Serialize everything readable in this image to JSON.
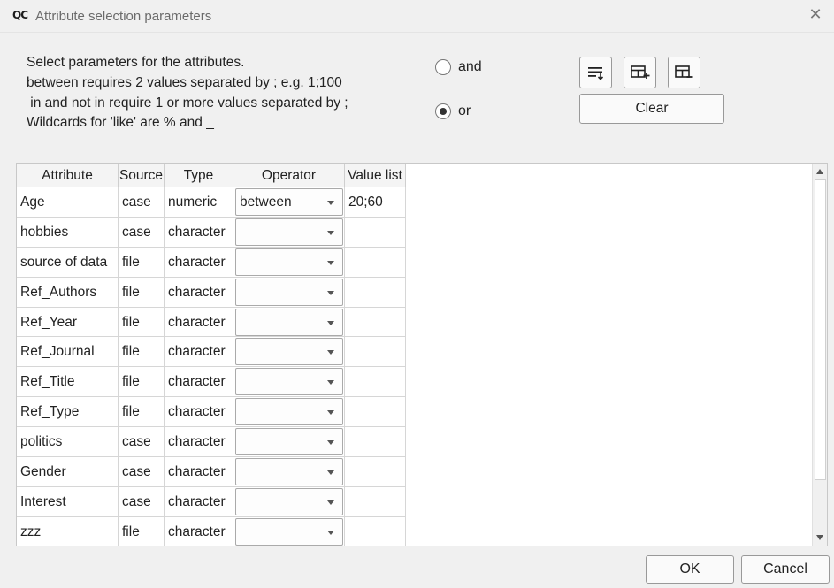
{
  "window": {
    "app_icon": "QC",
    "title": "Attribute selection parameters",
    "close_icon": "close-icon"
  },
  "instructions": [
    "Select parameters for the attributes.",
    "between requires 2 values separated by ; e.g. 1;100",
    " in and not in require 1 or more values separated by ;",
    "Wildcards for 'like' are % and _"
  ],
  "logic": {
    "and_label": "and",
    "or_label": "or",
    "selected": "or"
  },
  "toolbar": {
    "icons": [
      "sort-filter-icon",
      "add-row-icon",
      "remove-row-icon"
    ],
    "clear_label": "Clear"
  },
  "table": {
    "headers": [
      "Attribute",
      "Source",
      "Type",
      "Operator",
      "Value list"
    ],
    "rows": [
      {
        "attribute": "Age",
        "source": "case",
        "type": "numeric",
        "operator": "between",
        "value": "20;60"
      },
      {
        "attribute": "hobbies",
        "source": "case",
        "type": "character",
        "operator": "",
        "value": ""
      },
      {
        "attribute": "source of data",
        "source": "file",
        "type": "character",
        "operator": "",
        "value": ""
      },
      {
        "attribute": "Ref_Authors",
        "source": "file",
        "type": "character",
        "operator": "",
        "value": ""
      },
      {
        "attribute": "Ref_Year",
        "source": "file",
        "type": "character",
        "operator": "",
        "value": ""
      },
      {
        "attribute": "Ref_Journal",
        "source": "file",
        "type": "character",
        "operator": "",
        "value": ""
      },
      {
        "attribute": "Ref_Title",
        "source": "file",
        "type": "character",
        "operator": "",
        "value": ""
      },
      {
        "attribute": "Ref_Type",
        "source": "file",
        "type": "character",
        "operator": "",
        "value": ""
      },
      {
        "attribute": "politics",
        "source": "case",
        "type": "character",
        "operator": "",
        "value": ""
      },
      {
        "attribute": "Gender",
        "source": "case",
        "type": "character",
        "operator": "",
        "value": ""
      },
      {
        "attribute": "Interest",
        "source": "case",
        "type": "character",
        "operator": "",
        "value": ""
      },
      {
        "attribute": "zzz",
        "source": "file",
        "type": "character",
        "operator": "",
        "value": ""
      }
    ]
  },
  "buttons": {
    "ok_label": "OK",
    "cancel_label": "Cancel"
  }
}
